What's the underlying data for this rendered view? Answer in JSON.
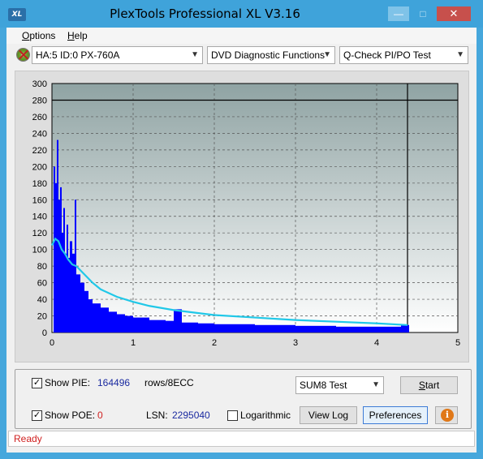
{
  "window": {
    "title": "PlexTools Professional XL V3.16",
    "app_icon_text": "XL",
    "minimize_icon": "minimize-icon",
    "maximize_icon": "maximize-icon",
    "close_icon": "close-icon"
  },
  "menu": {
    "items": [
      {
        "label": "Options",
        "accel": "O"
      },
      {
        "label": "Help",
        "accel": "H"
      }
    ]
  },
  "toolbar": {
    "drive": "HA:5 ID:0  PX-760A",
    "function": "DVD Diagnostic Functions",
    "test": "Q-Check PI/PO Test"
  },
  "chart_data": {
    "type": "bar",
    "title": "",
    "xlabel": "",
    "ylabel": "",
    "xlim": [
      0,
      5
    ],
    "ylim": [
      0,
      300
    ],
    "xticks": [
      0,
      1,
      2,
      3,
      4,
      5
    ],
    "yticks": [
      0,
      20,
      40,
      60,
      80,
      100,
      120,
      140,
      160,
      180,
      200,
      220,
      240,
      260,
      280,
      300
    ],
    "grid": true,
    "threshold": 280,
    "end_marker_x": 4.38,
    "colors": {
      "pie_bars": "#0000ff",
      "sum_line": "#20c8e8",
      "plot_bg_top": "#8fa3a3",
      "plot_bg_bottom": "#ffffff"
    },
    "series": [
      {
        "name": "PIE",
        "style": "bars",
        "x": [
          0.02,
          0.04,
          0.06,
          0.08,
          0.1,
          0.12,
          0.14,
          0.16,
          0.18,
          0.2,
          0.22,
          0.25,
          0.28,
          0.3,
          0.35,
          0.4,
          0.45,
          0.5,
          0.6,
          0.7,
          0.8,
          0.9,
          1.0,
          1.2,
          1.4,
          1.5,
          1.6,
          1.8,
          2.0,
          2.5,
          3.0,
          3.5,
          4.0,
          4.3
        ],
        "values": [
          200,
          180,
          232,
          160,
          175,
          120,
          150,
          95,
          130,
          90,
          110,
          95,
          160,
          70,
          60,
          50,
          40,
          35,
          30,
          25,
          22,
          20,
          18,
          15,
          14,
          28,
          12,
          11,
          10,
          9,
          8,
          7,
          7,
          9
        ]
      },
      {
        "name": "SUM8",
        "style": "line",
        "x": [
          0.0,
          0.04,
          0.08,
          0.12,
          0.16,
          0.2,
          0.25,
          0.3,
          0.4,
          0.5,
          0.6,
          0.8,
          1.0,
          1.2,
          1.5,
          2.0,
          2.5,
          3.0,
          3.5,
          4.0,
          4.38
        ],
        "values": [
          105,
          113,
          110,
          100,
          95,
          88,
          82,
          80,
          70,
          60,
          52,
          43,
          37,
          32,
          27,
          21,
          18,
          15,
          13,
          11,
          9
        ]
      }
    ]
  },
  "panel": {
    "show_pie_label": "Show PIE:",
    "pie_value": "164496",
    "pie_unit": "rows/8ECC",
    "show_poe_label": "Show POE:",
    "poe_value": "0",
    "lsn_label": "LSN:",
    "lsn_value": "2295040",
    "logarithmic_label": "Logarithmic",
    "show_pie_checked": true,
    "show_poe_checked": true,
    "logarithmic_checked": false,
    "sum_select": "SUM8 Test",
    "start_button": "Start",
    "view_log_button": "View Log",
    "preferences_button": "Preferences",
    "info_icon": "info-icon"
  },
  "status": {
    "text": "Ready"
  }
}
